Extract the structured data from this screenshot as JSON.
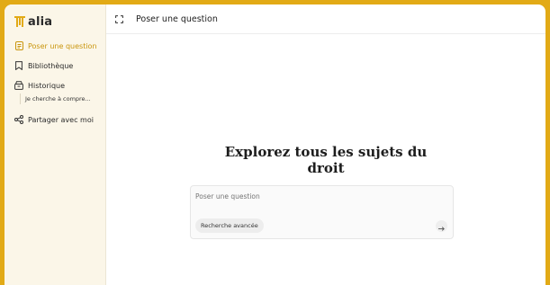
{
  "brand": {
    "name": "alia",
    "accent": "#e2aa16"
  },
  "sidebar": {
    "items": [
      {
        "label": "Poser une question",
        "icon": "document-icon",
        "active": true
      },
      {
        "label": "Bibliothèque",
        "icon": "bookmark-icon",
        "active": false
      },
      {
        "label": "Historique",
        "icon": "archive-box-icon",
        "active": false
      },
      {
        "label": "Partager avec moi",
        "icon": "share-icon",
        "active": false
      }
    ],
    "history": [
      {
        "label": "Je cherche à compre..."
      }
    ]
  },
  "header": {
    "title": "Poser une question",
    "toggle_icon": "expand-icon"
  },
  "main": {
    "headline_line1": "Explorez tous les sujets du",
    "headline_line2": "droit",
    "composer": {
      "placeholder": "Poser une question",
      "advanced_label": "Recherche avancée",
      "send_icon": "arrow-right-icon"
    }
  }
}
